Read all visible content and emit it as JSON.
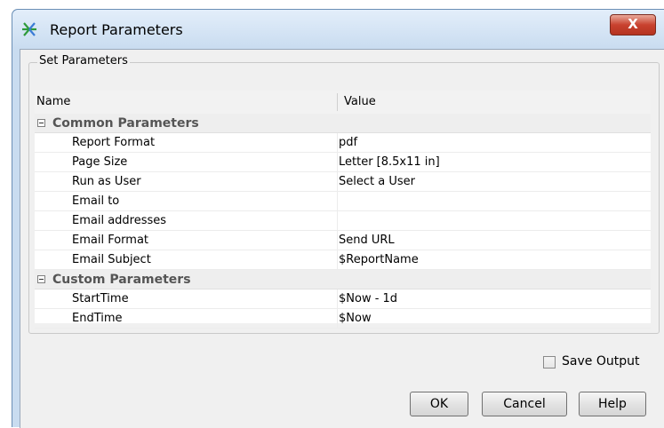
{
  "window": {
    "title": "Report Parameters",
    "close_label": "X",
    "app_icon": "report-params-icon"
  },
  "group": {
    "label": "Set Parameters",
    "columns": {
      "name": "Name",
      "value": "Value"
    },
    "sections": [
      {
        "label": "Common Parameters",
        "expanded": true,
        "rows": [
          {
            "name": "Report Format",
            "value": "pdf"
          },
          {
            "name": "Page Size",
            "value": "Letter [8.5x11 in]"
          },
          {
            "name": "Run as User",
            "value": "Select a User"
          },
          {
            "name": "Email to",
            "value": ""
          },
          {
            "name": "Email addresses",
            "value": ""
          },
          {
            "name": "Email Format",
            "value": "Send URL"
          },
          {
            "name": "Email Subject",
            "value": "$ReportName"
          }
        ]
      },
      {
        "label": "Custom Parameters",
        "expanded": true,
        "rows": [
          {
            "name": "StartTime",
            "value": "$Now - 1d"
          },
          {
            "name": "EndTime",
            "value": "$Now"
          }
        ]
      }
    ]
  },
  "save_output": {
    "label": "Save Output",
    "checked": false
  },
  "buttons": {
    "ok": "OK",
    "cancel": "Cancel",
    "help": "Help"
  },
  "colors": {
    "titlebar": "#c9dcf0",
    "close": "#c8422f",
    "section_text": "#555555",
    "dialog_bg": "#f0f0f0"
  }
}
